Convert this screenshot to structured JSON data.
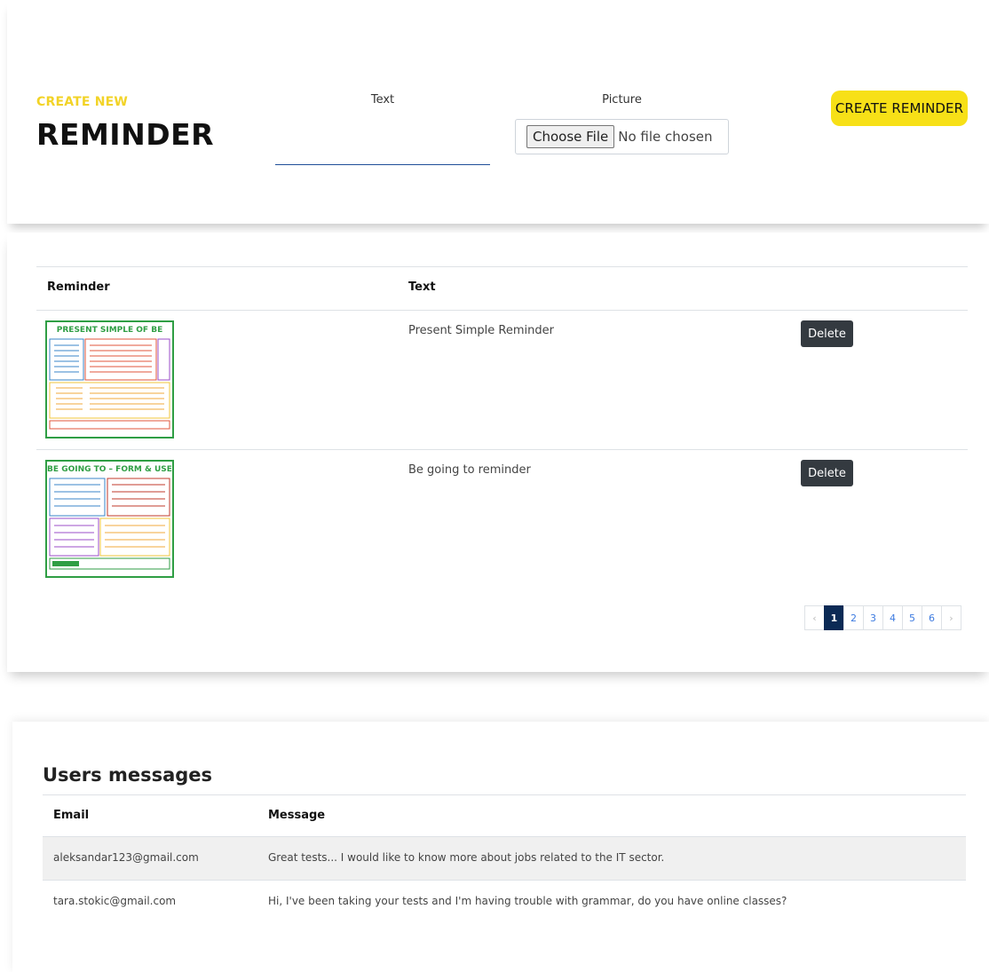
{
  "form": {
    "heading_small": "CREATE NEW",
    "heading_large": "REMINDER",
    "text_label": "Text",
    "text_value": "",
    "picture_label": "Picture",
    "file_button": "Choose File",
    "file_status": "No file chosen",
    "submit_label": "CREATE REMINDER",
    "accent_color": "#f7e017"
  },
  "reminders": {
    "headers": {
      "reminder": "Reminder",
      "text": "Text"
    },
    "rows": [
      {
        "image_title": "PRESENT SIMPLE OF BE",
        "text": "Present Simple Reminder",
        "delete_label": "Delete"
      },
      {
        "image_title": "BE GOING TO – FORM & USE",
        "text": "Be going to reminder",
        "delete_label": "Delete"
      }
    ],
    "pagination": {
      "prev": "‹",
      "next": "›",
      "pages": [
        "1",
        "2",
        "3",
        "4",
        "5",
        "6"
      ],
      "current": "1"
    }
  },
  "messages": {
    "title": "Users messages",
    "headers": {
      "email": "Email",
      "message": "Message"
    },
    "rows": [
      {
        "email": "aleksandar123@gmail.com",
        "message": "Great tests... I would like to know more about jobs related to the IT sector."
      },
      {
        "email": "tara.stokic@gmail.com",
        "message": "Hi, I've been taking your tests and I'm having trouble with grammar, do you have online classes?"
      }
    ]
  }
}
